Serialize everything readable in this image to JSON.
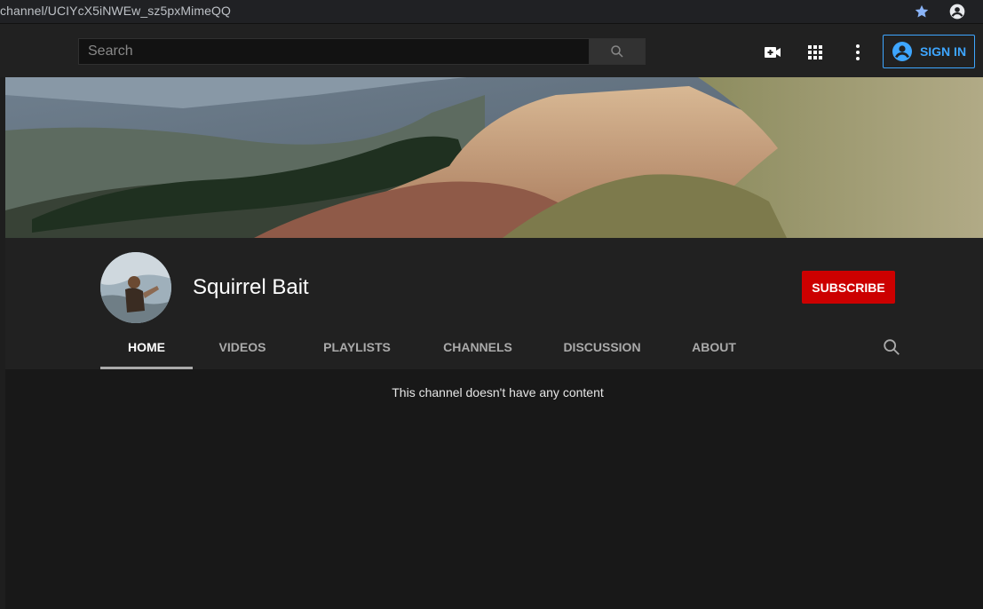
{
  "browser": {
    "url": "channel/UCIYcX5iNWEw_sz5pxMimeQQ"
  },
  "masthead": {
    "search_placeholder": "Search",
    "sign_in_label": "SIGN IN",
    "accent_color": "#3ea6ff"
  },
  "channel": {
    "name": "Squirrel Bait",
    "subscribe_label": "SUBSCRIBE",
    "subscribe_color": "#cc0000"
  },
  "tabs": [
    {
      "label": "HOME",
      "active": true
    },
    {
      "label": "VIDEOS",
      "active": false
    },
    {
      "label": "PLAYLISTS",
      "active": false
    },
    {
      "label": "CHANNELS",
      "active": false
    },
    {
      "label": "DISCUSSION",
      "active": false
    },
    {
      "label": "ABOUT",
      "active": false
    }
  ],
  "content": {
    "empty_message": "This channel doesn't have any content"
  },
  "icons": [
    "star-icon",
    "account-icon",
    "search-icon",
    "create-video-icon",
    "apps-icon",
    "more-vert-icon",
    "user-circle-icon"
  ]
}
